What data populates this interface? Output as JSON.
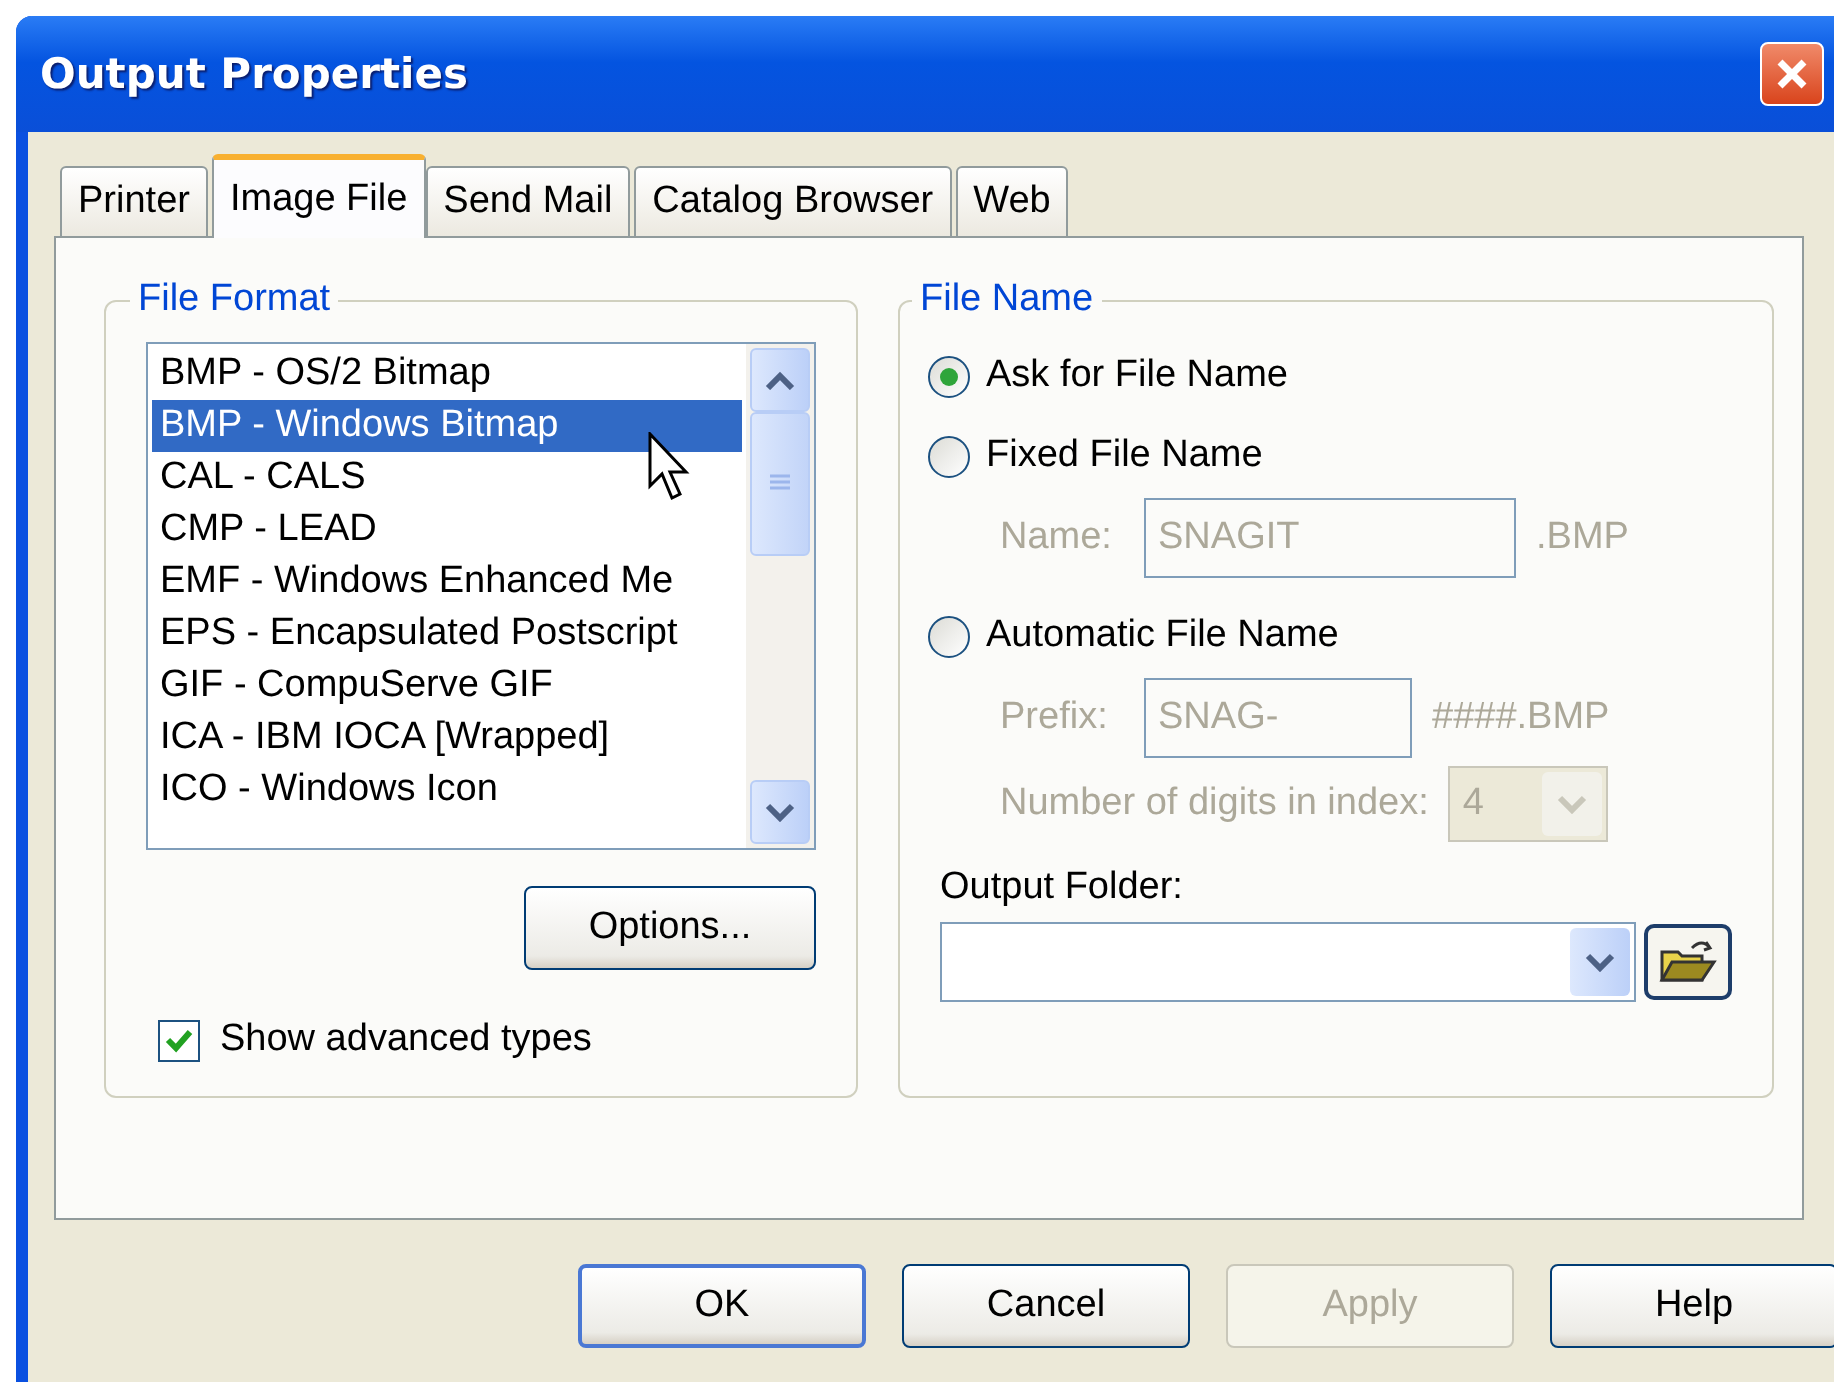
{
  "window": {
    "title": "Output Properties"
  },
  "tabs": [
    {
      "label": "Printer",
      "selected": false
    },
    {
      "label": "Image File",
      "selected": true
    },
    {
      "label": "Send Mail",
      "selected": false
    },
    {
      "label": "Catalog Browser",
      "selected": false
    },
    {
      "label": "Web",
      "selected": false
    }
  ],
  "file_format": {
    "legend": "File Format",
    "items": [
      {
        "label": "BMP - OS/2 Bitmap",
        "selected": false
      },
      {
        "label": "BMP - Windows Bitmap",
        "selected": true
      },
      {
        "label": "CAL - CALS",
        "selected": false
      },
      {
        "label": "CMP - LEAD",
        "selected": false
      },
      {
        "label": "EMF - Windows Enhanced Me",
        "selected": false
      },
      {
        "label": "EPS - Encapsulated Postscript",
        "selected": false
      },
      {
        "label": "GIF - CompuServe GIF",
        "selected": false
      },
      {
        "label": "ICA - IBM IOCA [Wrapped]",
        "selected": false
      },
      {
        "label": "ICO - Windows Icon",
        "selected": false
      }
    ],
    "options_button": "Options...",
    "advanced": {
      "label": "Show advanced types",
      "checked": true
    }
  },
  "file_name": {
    "legend": "File Name",
    "modes": [
      {
        "label": "Ask for File Name",
        "selected": true
      },
      {
        "label": "Fixed File Name",
        "selected": false
      },
      {
        "label": "Automatic File Name",
        "selected": false
      }
    ],
    "name": {
      "label": "Name:",
      "value": "SNAGIT",
      "suffix": ".BMP",
      "disabled": true
    },
    "prefix": {
      "label": "Prefix:",
      "value": "SNAG-",
      "suffix": "####.BMP",
      "disabled": true
    },
    "digits": {
      "label": "Number of digits in index:",
      "value": "4",
      "disabled": true
    },
    "output_folder": {
      "label": "Output Folder:"
    }
  },
  "buttons": [
    {
      "label": "OK",
      "disabled": false,
      "default": true
    },
    {
      "label": "Cancel",
      "disabled": false,
      "default": false
    },
    {
      "label": "Apply",
      "disabled": true,
      "default": false
    },
    {
      "label": "Help",
      "disabled": false,
      "default": false
    }
  ]
}
